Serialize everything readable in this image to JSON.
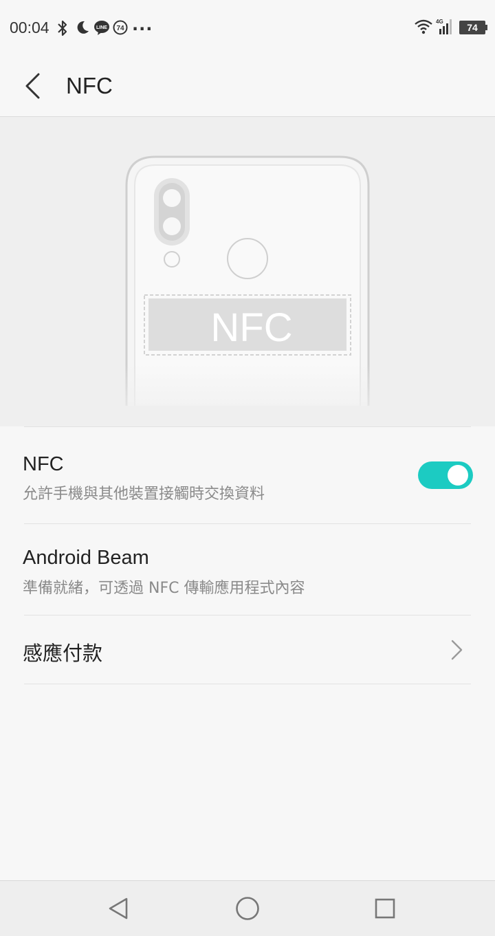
{
  "status_bar": {
    "time": "00:04",
    "icons": [
      "bluetooth-icon",
      "moon-icon",
      "line-app-icon",
      "notification-74-icon",
      "more-dots",
      "wifi-icon",
      "signal-4g-icon",
      "battery-icon"
    ],
    "notification_badge": "74",
    "more": "...",
    "network_label": "4G",
    "battery_level": "74"
  },
  "app_bar": {
    "title": "NFC",
    "back_icon": "back-arrow-icon"
  },
  "illustration": {
    "label": "NFC",
    "icon": "phone-back-nfc-illustration"
  },
  "settings": {
    "nfc": {
      "title": "NFC",
      "subtitle": "允許手機與其他裝置接觸時交換資料",
      "enabled": true
    },
    "android_beam": {
      "title": "Android Beam",
      "subtitle": "準備就緒，可透過 NFC 傳輸應用程式內容"
    },
    "tap_pay": {
      "title": "感應付款",
      "icon": "chevron-right-icon"
    }
  },
  "colors": {
    "accent": "#1ccbc2",
    "background": "#f7f7f7",
    "illustration_bg": "#efefef"
  },
  "nav_bar": {
    "icons": [
      "back-triangle-icon",
      "home-circle-icon",
      "recents-square-icon"
    ]
  }
}
